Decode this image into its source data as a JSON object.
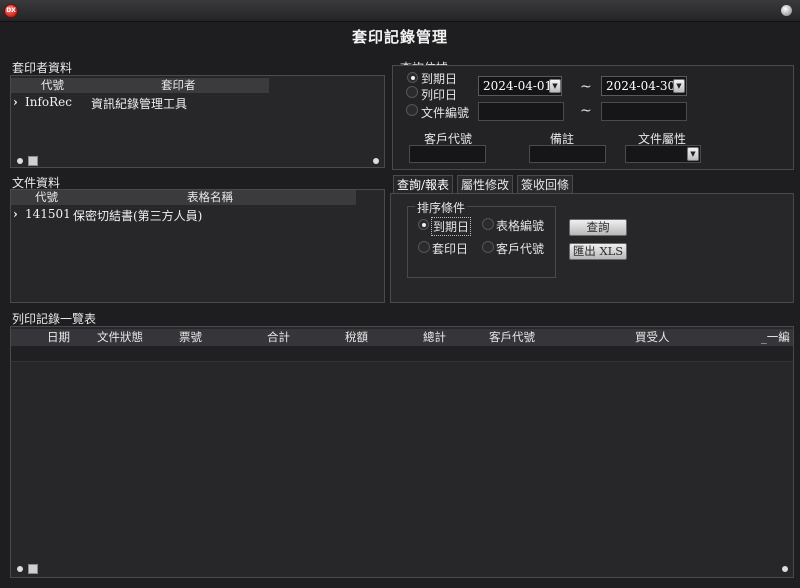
{
  "window": {
    "close_glyph": "DX",
    "title": "套印記錄管理"
  },
  "printer_section": {
    "label": "套印者資料",
    "columns": [
      "代號",
      "套印者"
    ],
    "rows": [
      {
        "marker": "›",
        "code": "InfoRec",
        "name": "資訊紀錄管理工具"
      }
    ]
  },
  "document_section": {
    "label": "文件資料",
    "columns": [
      "代號",
      "表格名稱"
    ],
    "rows": [
      {
        "marker": "›",
        "code": "141501",
        "name": "保密切結書(第三方人員)"
      }
    ]
  },
  "query": {
    "label": "查詢依據",
    "radio_due_date": "到期日",
    "radio_print_date": "列印日",
    "radio_doc_no": "文件編號",
    "date_from": "2024-04-01",
    "date_to": "2024-04-30",
    "tilde": "~",
    "customer_code_label": "客戶代號",
    "remark_label": "備註",
    "doc_attr_label": "文件屬性"
  },
  "tabs": [
    "查詢/報表",
    "屬性修改",
    "簽收回條"
  ],
  "sort": {
    "label": "排序條件",
    "options": [
      "到期日",
      "表格編號",
      "套印日",
      "客戶代號"
    ],
    "selected_index": 0
  },
  "buttons": {
    "query": "查詢",
    "export_xls": "匯出 XLS"
  },
  "print_list": {
    "label": "列印記錄一覽表",
    "columns": [
      "日期",
      "文件狀態",
      "票號",
      "合計",
      "稅額",
      "總計",
      "客戶代號",
      "買受人",
      "_一編"
    ]
  }
}
